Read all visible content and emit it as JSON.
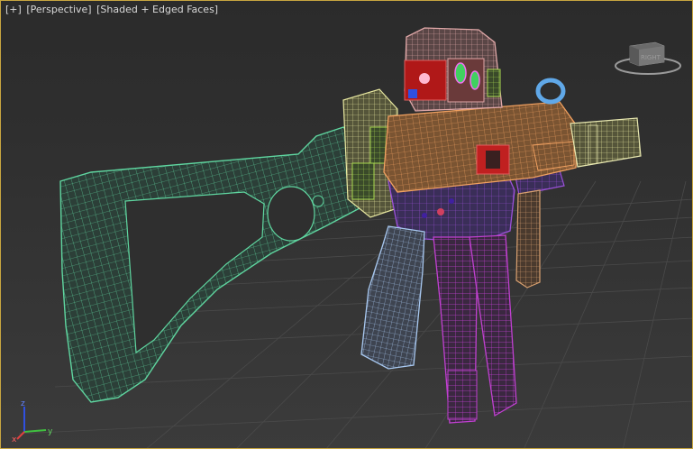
{
  "viewport": {
    "menu_label": "[+]",
    "view_label": "[Perspective]",
    "shading_label": "[Shaded + Edged Faces]"
  },
  "viewcube": {
    "face_label": "RIGHT"
  },
  "axis": {
    "x_label": "x",
    "y_label": "y",
    "z_label": "z"
  },
  "colors": {
    "stock": "#5fd6a0",
    "upper_receiver": "#f0a060",
    "lower_receiver": "#9a50d8",
    "magazine": "#c040d0",
    "grip": "#a8c8f0",
    "foregrip": "#d8a070",
    "sight_body": "#e0a8a8",
    "sight_red": "#c02020",
    "rail": "#e8e8a0",
    "barrel": "#e8e8b0",
    "sling_ring": "#60a8e8",
    "accent_yellow": "#c8c840"
  },
  "icons": {
    "viewcube": "viewcube-icon",
    "axis": "axis-tripod-icon"
  }
}
